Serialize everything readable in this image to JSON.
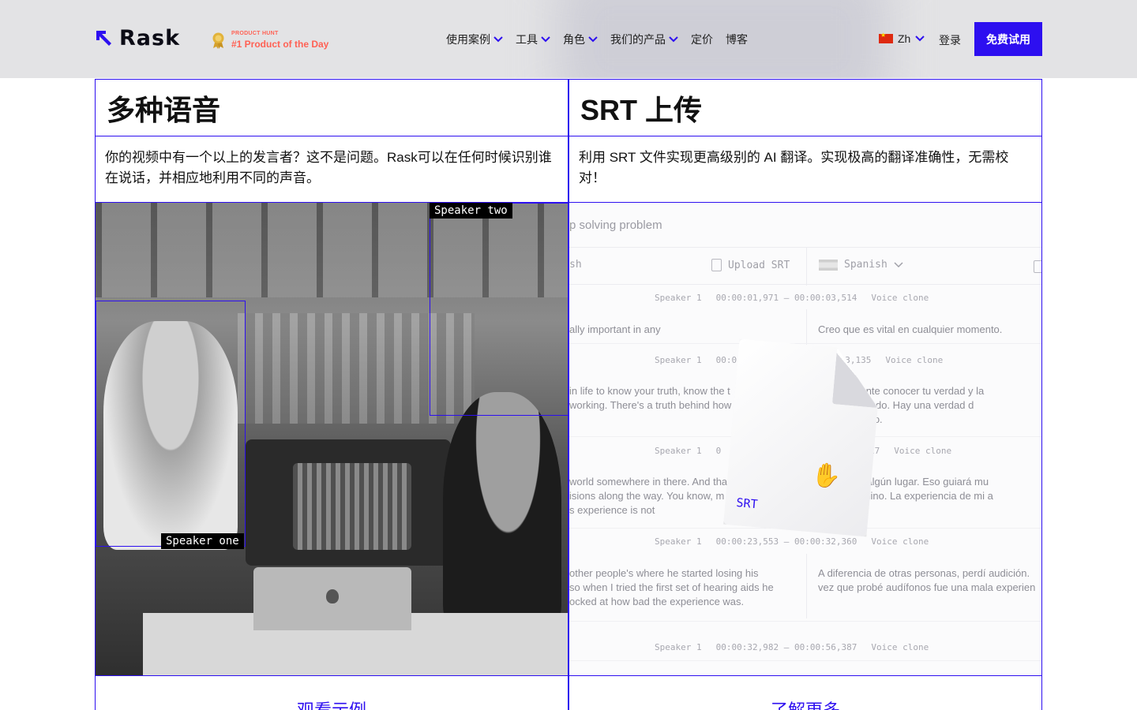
{
  "header": {
    "brand": "Rask",
    "product_hunt": {
      "small": "PRODUCT HUNT",
      "big": "#1 Product of the Day"
    },
    "nav": [
      {
        "label": "使用案例",
        "has_dropdown": true
      },
      {
        "label": "工具",
        "has_dropdown": true
      },
      {
        "label": "角色",
        "has_dropdown": true
      },
      {
        "label": "我们的产品",
        "has_dropdown": true
      },
      {
        "label": "定价",
        "has_dropdown": false
      },
      {
        "label": "博客",
        "has_dropdown": false
      }
    ],
    "language": "Zh",
    "login": "登录",
    "cta": "免费试用"
  },
  "cards": [
    {
      "title": "多种语音",
      "description": "你的视频中有一个以上的发言者？这不是问题。Rask可以在任何时候识别谁在说话，并相应地利用不同的声音。",
      "media": {
        "speaker_one": "Speaker one",
        "speaker_two": "Speaker two"
      },
      "link": "观看示例"
    },
    {
      "title": "SRT 上传",
      "description": "利用 SRT 文件实现更高级别的 AI 翻译。实现极高的翻译准确性，无需校对！",
      "editor": {
        "title": "p solving problem",
        "source_lang": "sh",
        "upload": "Upload SRT",
        "target_lang": "Spanish",
        "file_label": "SRT",
        "segments": [
          {
            "speaker": "Speaker 1",
            "time": "00:00:01,971 — 00:00:03,514",
            "voice": "Voice clone",
            "src": "ally important in any",
            "tgt": "Creo que es vital en cualquier momento."
          },
          {
            "speaker": "Speaker 1",
            "time": "00:0",
            "time_tail": ":13,135",
            "voice": "Voice clone",
            "src": "in life to know your truth, know the t\nworking. There's a truth behind how",
            "tgt": "es importante conocer tu verdad y la\nestás haciendo. Hay una verdad d\nfuncionar eso."
          },
          {
            "speaker": "Speaker 1",
            "time": "0",
            "time_tail": "17",
            "voice": "Voice clone",
            "src": "world somewhere in there. And tha\nisions along the way. You know, m\ns experience is not",
            "tgt": "mundo en algún lugar. Eso guiará mu\ns en el camino. La experiencia de mi a"
          },
          {
            "speaker": "Speaker 1",
            "time": "00:00:23,553 — 00:00:32,360",
            "voice": "Voice clone",
            "src": "other people's where he started losing his\nso when I tried the first set of hearing aids he\nocked at how bad the experience was.",
            "tgt": "A diferencia de otras personas, perdí audición.\nvez que probé audífonos fue una mala experien"
          },
          {
            "speaker": "Speaker 1",
            "time": "00:00:32,982 — 00:00:56,387",
            "voice": "Voice clone",
            "src": "",
            "tgt": ""
          }
        ]
      },
      "link": "了解更多"
    }
  ],
  "colors": {
    "accent": "#2d0ff0",
    "header_bg": "#e3e3e5",
    "product_hunt": "#ff6154"
  }
}
